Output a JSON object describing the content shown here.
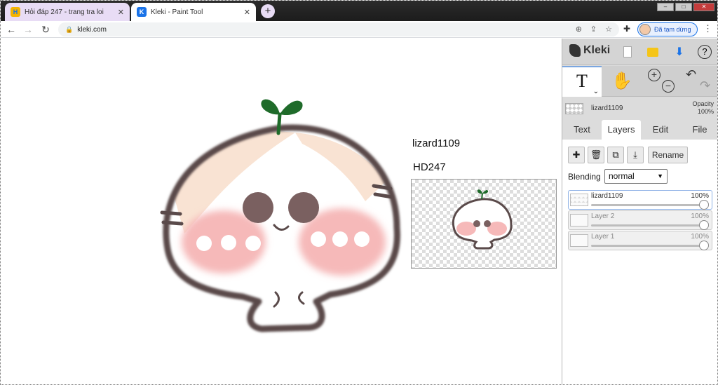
{
  "browser": {
    "tabs": [
      {
        "title": "Hỏi đáp 247 - trang tra loi",
        "favicon": "H",
        "close": "✕"
      },
      {
        "title": "Kleki - Paint Tool",
        "favicon": "K",
        "close": "✕"
      }
    ],
    "new_tab": "+",
    "window_controls": {
      "minimize": "–",
      "maximize": "□",
      "close": "✕"
    },
    "url": "kleki.com",
    "profile_label": "Đã tạm dừng"
  },
  "canvas": {
    "text_lines": [
      "lizard1109",
      "HD247"
    ],
    "palette": {
      "outline": "#5a4a4a",
      "cheek": "#f6b9b9",
      "face": "#f9e3d3",
      "sprout": "#1f6b2a"
    }
  },
  "app": {
    "logo": "Kleki",
    "current_layer": {
      "name": "lizard1109",
      "opacity_label": "Opacity",
      "opacity_value": "100%"
    },
    "tabs": [
      {
        "label": "Text",
        "active": false
      },
      {
        "label": "Layers",
        "active": true
      },
      {
        "label": "Edit",
        "active": false
      },
      {
        "label": "File",
        "active": false
      }
    ],
    "rename_label": "Rename",
    "blending_label": "Blending",
    "blending_value": "normal",
    "layers": [
      {
        "name": "lizard1109",
        "opacity": "100%",
        "selected": true
      },
      {
        "name": "Layer 2",
        "opacity": "100%",
        "selected": false
      },
      {
        "name": "Layer 1",
        "opacity": "100%",
        "selected": false
      }
    ],
    "accent": "#1a73e8"
  }
}
